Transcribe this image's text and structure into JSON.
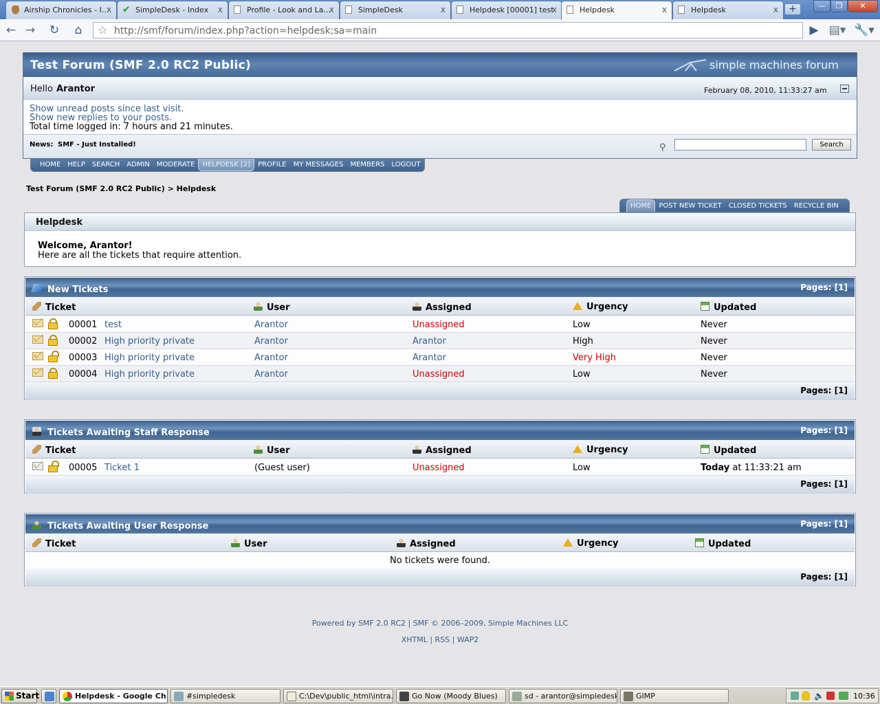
{
  "browser": {
    "tabs": [
      {
        "title": "Airship Chronicles - I...",
        "icon": "airship-icon"
      },
      {
        "title": "SimpleDesk - Index",
        "icon": "check-icon"
      },
      {
        "title": "Profile - Look and La...",
        "icon": "page-icon"
      },
      {
        "title": "SimpleDesk",
        "icon": "page-icon"
      },
      {
        "title": "Helpdesk [00001] test",
        "icon": "page-icon"
      },
      {
        "title": "Helpdesk",
        "icon": "page-icon"
      },
      {
        "title": "Helpdesk",
        "icon": "page-icon"
      }
    ],
    "close_glyph": "x",
    "new_tab_glyph": "+",
    "url": "http://smf/forum/index.php?action=helpdesk;sa=main",
    "window_buttons": [
      "—",
      "❐",
      "✕"
    ]
  },
  "forum": {
    "title": "Test Forum (SMF 2.0 RC2 Public)",
    "logo_text": "simple machines forum",
    "hello": "Hello",
    "username": "Arantor",
    "datetime": "February 08, 2010, 11:33:27 am",
    "links": [
      "Show unread posts since last visit.",
      "Show new replies to your posts."
    ],
    "time_logged": "Total time logged in: 7 hours and 21 minutes.",
    "news_label": "News:",
    "news_text": "SMF - Just Installed!",
    "search_button": "Search",
    "search_value": ""
  },
  "main_menu": [
    "HOME",
    "HELP",
    "SEARCH",
    "ADMIN",
    "MODERATE",
    "HELPDESK [2]",
    "PROFILE",
    "MY MESSAGES",
    "MEMBERS",
    "LOGOUT"
  ],
  "main_menu_active": "HELPDESK [2]",
  "breadcrumb": {
    "root": "Test Forum (SMF 2.0 RC2 Public)",
    "sep": ">",
    "current": "Helpdesk"
  },
  "helpdesk_menu": [
    "HOME",
    "POST NEW TICKET",
    "CLOSED TICKETS",
    "RECYCLE BIN"
  ],
  "helpdesk": {
    "title": "Helpdesk",
    "welcome": "Welcome, Arantor!",
    "subtext": "Here are all the tickets that require attention."
  },
  "columns": [
    "Ticket",
    "User",
    "Assigned",
    "Urgency",
    "Updated"
  ],
  "pages_label": "Pages:",
  "pages_value": "[1]",
  "sections": [
    {
      "title": "New Tickets",
      "rows": [
        {
          "id": "00001",
          "subject": "test",
          "user": "Arantor",
          "assigned": "Unassigned",
          "urgency": "Low",
          "updated": "Never"
        },
        {
          "id": "00002",
          "subject": "High priority private",
          "user": "Arantor",
          "assigned": "Arantor",
          "urgency": "High",
          "updated": "Never"
        },
        {
          "id": "00003",
          "subject": "High priority private",
          "user": "Arantor",
          "assigned": "Arantor",
          "urgency": "Very High",
          "updated": "Never"
        },
        {
          "id": "00004",
          "subject": "High priority private",
          "user": "Arantor",
          "assigned": "Unassigned",
          "urgency": "Low",
          "updated": "Never"
        }
      ]
    },
    {
      "title": "Tickets Awaiting Staff Response",
      "rows": [
        {
          "id": "00005",
          "subject": "Ticket 1",
          "user": "(Guest user)",
          "assigned": "Unassigned",
          "urgency": "Low",
          "updated_bold": "Today",
          "updated": " at 11:33:21 am"
        }
      ]
    },
    {
      "title": "Tickets Awaiting User Response",
      "empty": "No tickets were found."
    }
  ],
  "footer": {
    "powered": "Powered by SMF 2.0 RC2 | SMF © 2006–2009, Simple Machines LLC",
    "links": [
      "XHTML",
      "RSS",
      "WAP2"
    ]
  },
  "taskbar": {
    "start": "Start",
    "items": [
      "Helpdesk - Google Ch...",
      "#simpledesk",
      "C:\\Dev\\public_html\\intra...",
      "Go Now (Moody Blues)",
      "sd - arantor@simpledesk...",
      "GIMP"
    ],
    "clock": "10:36"
  },
  "colors": {
    "header": "#4a6f9c",
    "link": "#335e8c",
    "alert": "#cc0000"
  }
}
